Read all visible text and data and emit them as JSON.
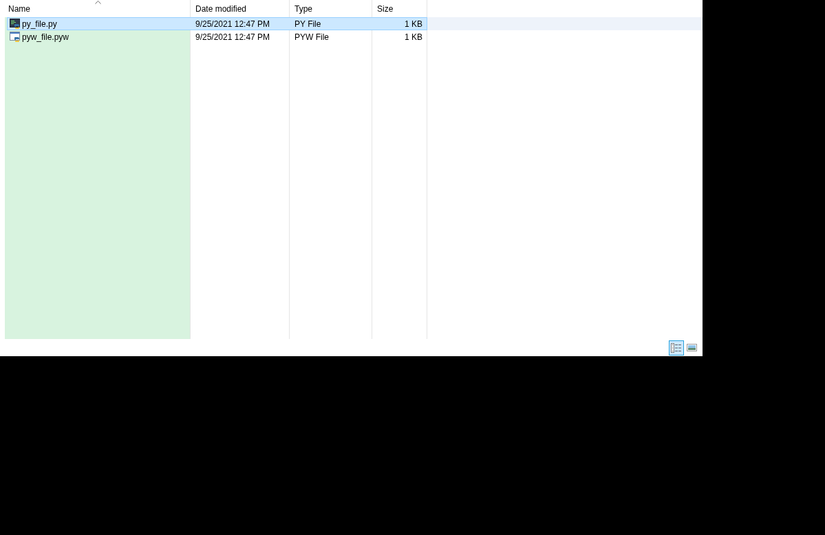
{
  "columns": [
    {
      "label": "Name",
      "sorted": true
    },
    {
      "label": "Date modified",
      "sorted": false
    },
    {
      "label": "Type",
      "sorted": false
    },
    {
      "label": "Size",
      "sorted": false
    }
  ],
  "rows": [
    {
      "kind": "py",
      "name": "py_file.py",
      "date_modified": "9/25/2021 12:47 PM",
      "type": "PY File",
      "size": "1 KB",
      "selected": true
    },
    {
      "kind": "pyw",
      "name": "pyw_file.pyw",
      "date_modified": "9/25/2021 12:47 PM",
      "type": "PYW File",
      "size": "1 KB",
      "selected": false
    }
  ],
  "status_bar": {
    "view_buttons": [
      {
        "kind": "details",
        "selected": true
      },
      {
        "kind": "large_icons",
        "selected": false
      }
    ]
  }
}
